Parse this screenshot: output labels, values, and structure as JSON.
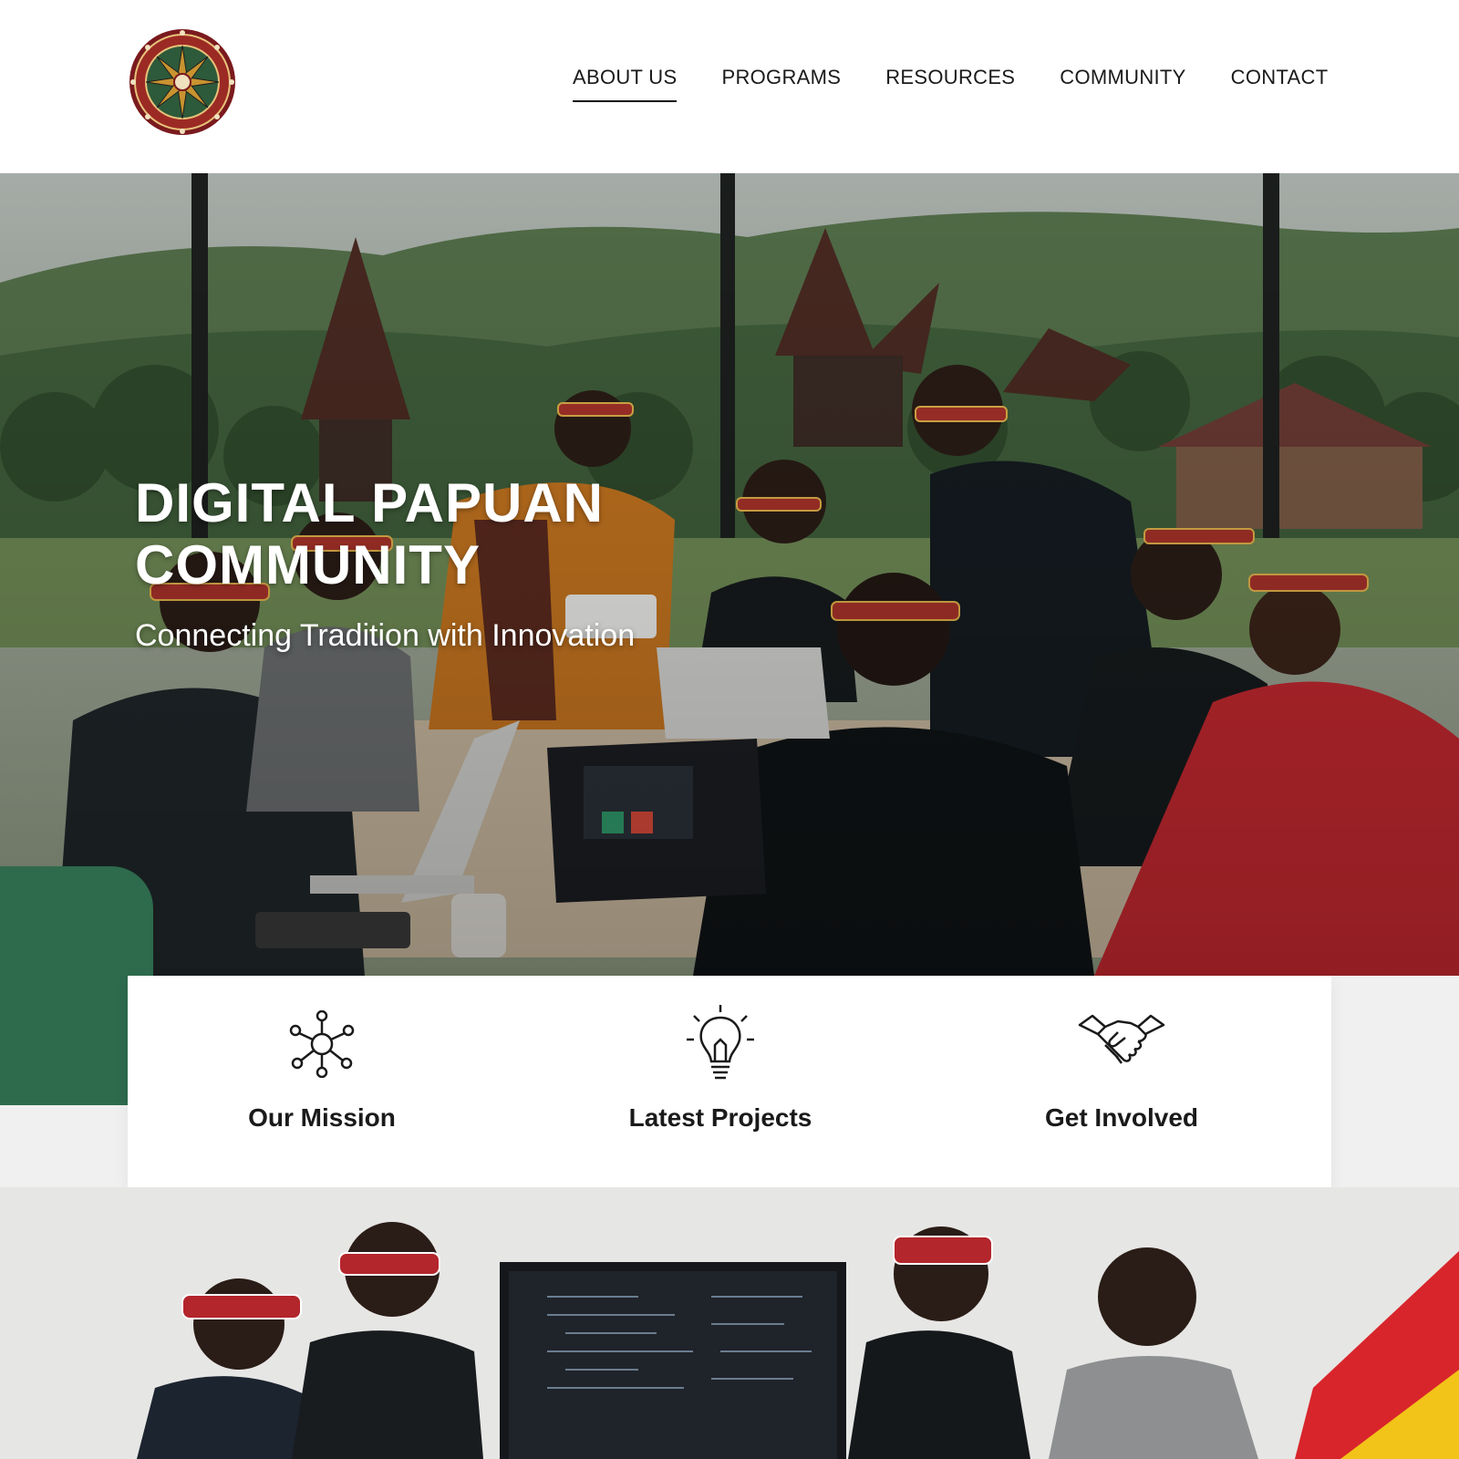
{
  "header": {
    "logo_icon": "tribal-shield-logo-icon",
    "nav": [
      {
        "label": "ABOUT US",
        "active": true
      },
      {
        "label": "PROGRAMS",
        "active": false
      },
      {
        "label": "RESOURCES",
        "active": false
      },
      {
        "label": "COMMUNITY",
        "active": false
      },
      {
        "label": "CONTACT",
        "active": false
      }
    ]
  },
  "hero": {
    "title_line1": "DIGITAL PAPUAN",
    "title_line2": "COMMUNITY",
    "subtitle": "Connecting Tradition with Innovation"
  },
  "features": [
    {
      "label": "Our Mission",
      "icon": "network-icon"
    },
    {
      "label": "Latest Projects",
      "icon": "lightbulb-icon"
    },
    {
      "label": "Get Involved",
      "icon": "handshake-icon"
    }
  ],
  "colors": {
    "accent_green": "#2e6a4c",
    "accent_red": "#d8252b",
    "accent_yellow": "#f2c318",
    "text": "#1a1a1a"
  }
}
